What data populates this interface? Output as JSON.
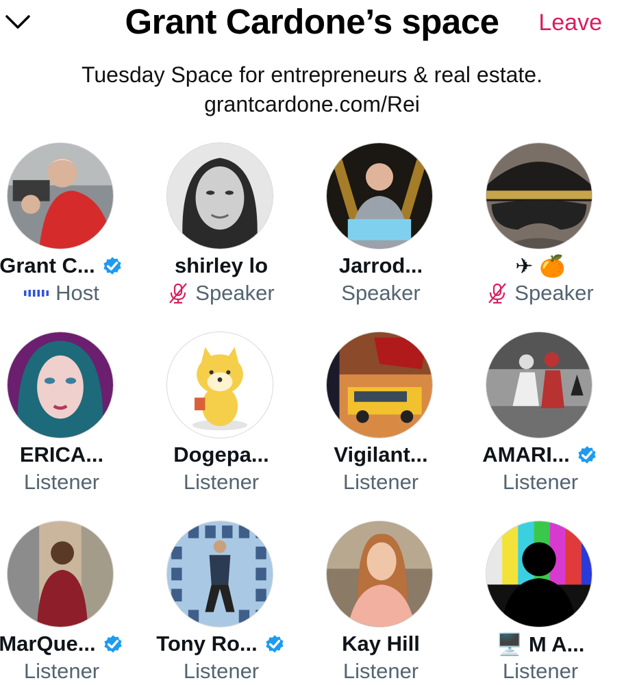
{
  "header": {
    "title": "Grant Cardone’s space",
    "leave_label": "Leave",
    "collapse_icon": "chevron-down-icon"
  },
  "description": {
    "line1": "Tuesday Space for entrepreneurs & real estate.",
    "line2": "grantcardone.com/Rei"
  },
  "colors": {
    "leave": "#d81e5b",
    "verified": "#1d9bf0",
    "muted_mic": "#d81e5b",
    "host_bars": "#2f52e0",
    "role_text": "#536471"
  },
  "participants": [
    {
      "name": "Grant C...",
      "role": "Host",
      "verified": true,
      "status_icon": "host-speaking-bars-icon"
    },
    {
      "name": "shirley lo",
      "role": "Speaker",
      "verified": false,
      "status_icon": "mic-muted-icon"
    },
    {
      "name": "Jarrod...",
      "role": "Speaker",
      "verified": false,
      "status_icon": ""
    },
    {
      "name": "✈ 🍊",
      "role": "Speaker",
      "verified": false,
      "status_icon": "mic-muted-icon"
    },
    {
      "name": "ERICA...",
      "role": "Listener",
      "verified": false
    },
    {
      "name": "Dogepa...",
      "role": "Listener",
      "verified": false
    },
    {
      "name": "Vigilant...",
      "role": "Listener",
      "verified": false
    },
    {
      "name": "AMARI...",
      "role": "Listener",
      "verified": true
    },
    {
      "name": "MarQue...",
      "role": "Listener",
      "verified": true
    },
    {
      "name": "Tony Ro...",
      "role": "Listener",
      "verified": true
    },
    {
      "name": "Kay Hill",
      "role": "Listener",
      "verified": false
    },
    {
      "name": "🖥️ M A...",
      "role": "Listener",
      "verified": false
    }
  ]
}
